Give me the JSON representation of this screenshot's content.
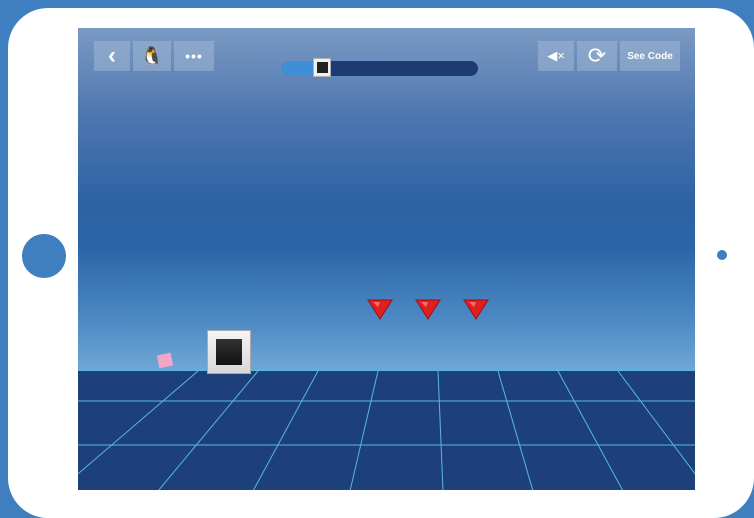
{
  "toolbar": {
    "back_icon": "‹",
    "avatar_icon": "🐧",
    "more_label": "•••",
    "mute_icon": "◀×",
    "restart_icon": "⟳",
    "see_code_label": "See Code"
  },
  "level_progress": {
    "fraction": 0.22
  },
  "game": {
    "hazards": [
      {
        "type": "spike-down"
      },
      {
        "type": "spike-down"
      },
      {
        "type": "spike-down"
      }
    ]
  },
  "colors": {
    "frame": "#3f7ebf",
    "floor": "#1d3f7a",
    "grid_line": "#57b9e0",
    "spike": "#e02020",
    "progress_fill": "#3f8fd6",
    "progress_track": "#1d3a72",
    "pink_block": "#f4a6c8"
  }
}
